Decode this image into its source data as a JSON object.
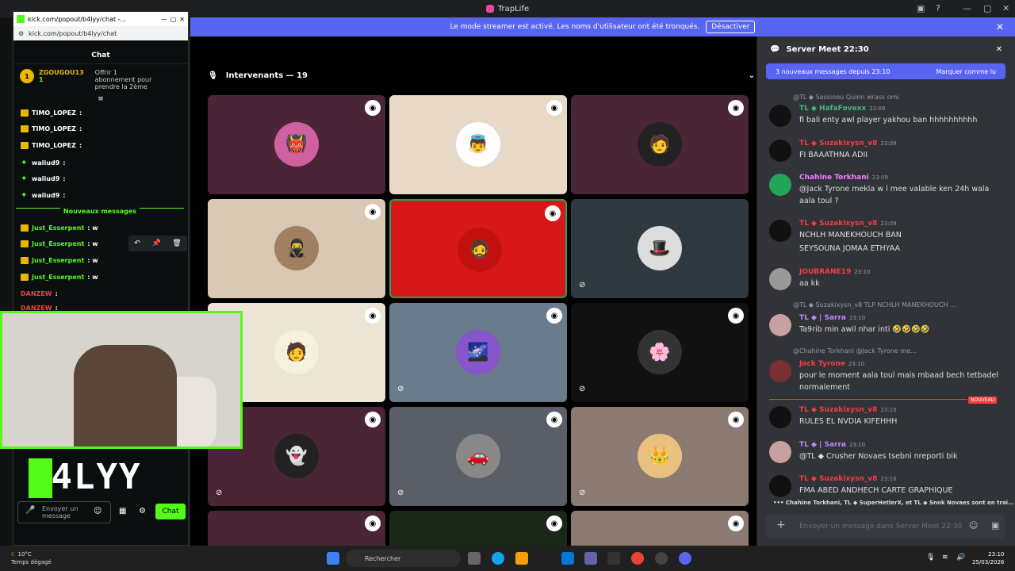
{
  "window": {
    "title": "TrapLife"
  },
  "banner": {
    "text": "Le mode streamer est activé. Les noms d'utilisateur ont été tronqués.",
    "button": "Désactiver"
  },
  "voice": {
    "header": "Intervenants — 19"
  },
  "popup": {
    "title": "kick.com/popout/b4lyy/chat -...",
    "url": "kick.com/popout/b4lyy/chat",
    "chat_header": "Chat",
    "sub": {
      "rank": "1",
      "user": "ZGOUGOU13",
      "count": "1",
      "text": "Offrir 1 abonnement pour prendre la 2ème"
    },
    "messages": [
      {
        "user": "TIMO_LOPEZ",
        "text": ":",
        "color": "#ffffff"
      },
      {
        "user": "TIMO_LOPEZ",
        "text": ":",
        "color": "#ffffff"
      },
      {
        "user": "TIMO_LOPEZ",
        "text": ":",
        "color": "#ffffff"
      },
      {
        "user": "waliud9",
        "text": ":",
        "color": "#ffffff"
      },
      {
        "user": "waliud9",
        "text": ":",
        "color": "#ffffff"
      },
      {
        "user": "waliud9",
        "text": ":",
        "color": "#ffffff"
      }
    ],
    "new_messages": "Nouveaux messages",
    "messages2": [
      {
        "user": "Just_Esserpent",
        "text": ": w"
      },
      {
        "user": "Just_Esserpent",
        "text": ": w"
      },
      {
        "user": "Just_Esserpent",
        "text": ": w"
      },
      {
        "user": "Just_Esserpent",
        "text": ": w"
      },
      {
        "user": "DANZEW",
        "text": ":"
      },
      {
        "user": "DANZEW",
        "text": ":"
      }
    ],
    "brand": "B4LYY",
    "input_placeholder": "Envoyer un message",
    "chat_button": "Chat"
  },
  "server": {
    "title": "Server Meet 22:30",
    "unread": "3 nouveaux messages depuis 23:10",
    "mark_read": "Marquer comme lu",
    "messages": [
      {
        "name": "TL ◆ HafaFovexx",
        "time": "23:09",
        "text": "fi bali enty awl player yakhou ban hhhhhhhhhh",
        "color": "#43b581"
      },
      {
        "name": "TL ◆ Suzakixysn_v8",
        "time": "23:09",
        "text": "FI BAAATHNA ADII",
        "color": "#f23f43"
      },
      {
        "name": "Chahine Torkhani",
        "time": "23:09",
        "text": "@Jack Tyrone mekla w l mee valable ken 24h wala",
        "text2": "aala toul ?",
        "color": "#f47fff"
      },
      {
        "name": "TL ◆ Suzakixysn_v8",
        "time": "23:09",
        "text": "NCHLH MANEKHOUCH BAN",
        "text2": "SEYSOUNA JOMAA ETHYAA",
        "color": "#f23f43"
      },
      {
        "name": "JOUBRANE19",
        "time": "23:10",
        "text": "aa kk",
        "color": "#f23f43"
      },
      {
        "name": "TL ◆ | Sarra",
        "time": "23:10",
        "text": "Ta9rib min awil nhar inti 🤣🤣🤣🤣",
        "color": "#c084fc"
      },
      {
        "name": "Jack Tyrone",
        "time": "23:10",
        "text": "pour le moment aala toul mais mbaad bech tetbadel",
        "text2": "normalement",
        "color": "#f23f43"
      },
      {
        "name": "TL ◆ Suzakixysn_v8",
        "time": "23:10",
        "text": "RULES EL NVDIA KIFEHHH",
        "color": "#f23f43"
      },
      {
        "name": "TL ◆ | Sarra",
        "time": "23:10",
        "text": "@TL ◆ Crusher Novaes tsebni nreporti bik",
        "color": "#c084fc"
      },
      {
        "name": "TL ◆ Suzakixysn_v8",
        "time": "23:10",
        "text": "FMA ABED ANDHECH CARTE GRAPHIQUE",
        "color": "#f23f43"
      }
    ],
    "replies": [
      "@TL ◆ Sassinou Quinn wrass omi",
      "@TL ◆ Suzakixysn_v8 TLP NCHLH MANEKHOUCH ...",
      "@Chahine Torkhani @Jack Tyrone me..."
    ],
    "new_label": "NOUVEAU",
    "typing": "Chahine Torkhani, TL ◆ SuperHetlerX, et TL ◆ Snok Novaes sont en trai...",
    "input_placeholder": "Envoyer un message dans Server Meet 22:30"
  },
  "taskbar": {
    "temp": "10°C",
    "weather": "Temps dégagé",
    "search": "Rechercher",
    "time": "23:10",
    "date": "25/03/2026"
  }
}
